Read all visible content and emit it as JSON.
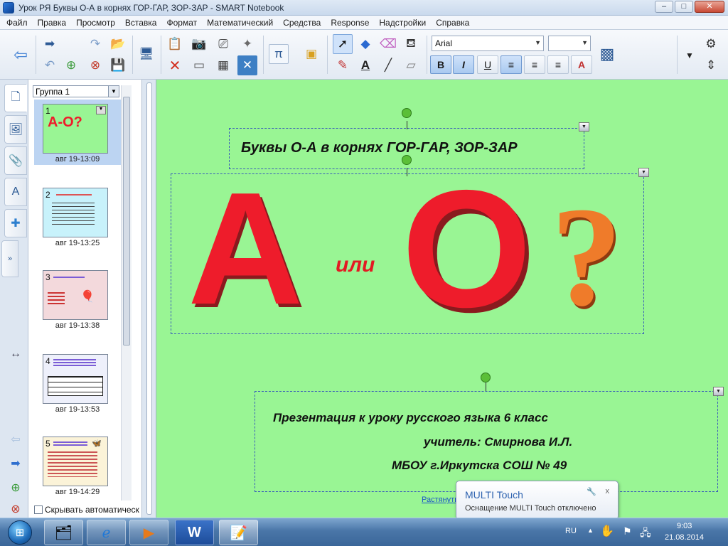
{
  "window": {
    "title": "Урок РЯ Буквы О-А в корнях ГОР-ГАР, ЗОР-ЗАР - SMART Notebook",
    "minimize": "–",
    "maximize": "□",
    "close": "✕"
  },
  "menu": [
    "Файл",
    "Правка",
    "Просмотр",
    "Вставка",
    "Формат",
    "Математический",
    "Средства",
    "Response",
    "Надстройки",
    "Справка"
  ],
  "toolbar": {
    "font_name": "Arial",
    "font_size": "",
    "bold": "B",
    "italic": "I",
    "underline": "U",
    "pi": "π",
    "text_color_glyph": "A"
  },
  "sorter": {
    "group": "Группа 1",
    "autohide_label": "Скрывать автоматическ",
    "pages": [
      {
        "num": "1",
        "time": "авг 19-13:09"
      },
      {
        "num": "2",
        "time": "авг 19-13:25"
      },
      {
        "num": "3",
        "time": "авг 19-13:38"
      },
      {
        "num": "4",
        "time": "авг 19-13:53"
      },
      {
        "num": "5",
        "time": "авг 19-14:29"
      }
    ],
    "thumb1_text": "А-О?"
  },
  "slide": {
    "title": "Буквы О-А в корнях ГОР-ГАР, ЗОР-ЗАР",
    "letter_a": "А",
    "word_or": "или",
    "letter_o": "О",
    "question": "?",
    "pres_line1": "Презентация к уроку русского языка 6 класс",
    "pres_line2": "учитель: Смирнова И.Л.",
    "pres_line3": "МБОУ г.Иркутска СОШ № 49",
    "stretch_link": "Растянуть",
    "object_menu": "▼"
  },
  "popup": {
    "title": "MULTI Touch",
    "text": "Оснащение MULTI Touch отключено",
    "close": "x"
  },
  "taskbar": {
    "lang": "RU",
    "time": "9:03",
    "date": "21.08.2014",
    "word_letter": "W"
  },
  "colors": {
    "canvas_bg": "#99f594",
    "letter_red": "#ee1c2b",
    "question_orange": "#ef7b2a",
    "selection_blue": "#3a5fb8"
  }
}
